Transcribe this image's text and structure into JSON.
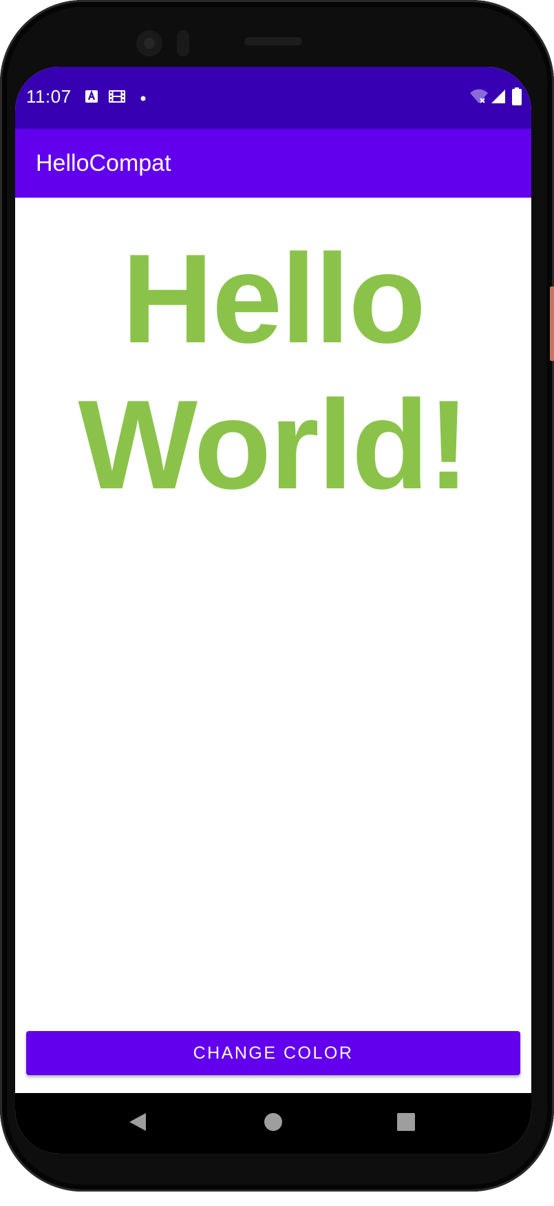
{
  "status_bar": {
    "time": "11:07",
    "left_icons": [
      "font-notification-icon",
      "film-notification-icon",
      "dot-notification-icon"
    ],
    "right_icons": [
      "wifi-off-icon",
      "cell-signal-icon",
      "battery-icon"
    ],
    "background": "#3700b3"
  },
  "app_bar": {
    "title": "HelloCompat",
    "background": "#6200ee"
  },
  "main": {
    "hello_line1": "Hello",
    "hello_line2": "World!",
    "text_color": "#8bc34a"
  },
  "actions": {
    "change_color_label": "CHANGE COLOR",
    "button_color": "#6200ee"
  },
  "navigation": {
    "items": [
      "back-icon",
      "home-icon",
      "recents-icon"
    ]
  }
}
